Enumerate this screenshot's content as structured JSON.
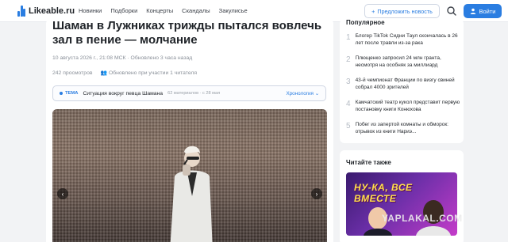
{
  "header": {
    "logo_text": "Likeable.ru",
    "nav": [
      "Новинки",
      "Подборки",
      "Концерты",
      "Скандалы",
      "Закулисье"
    ],
    "suggest_label": "Предложить новость",
    "login_label": "Войти"
  },
  "article": {
    "title": "Шаман в Лужниках трижды пытался вовлечь зал в пение — молчание",
    "date_line": "10 августа 2026 г., 21:08 МСК  ·  Обновлено 3 часа назад",
    "views": "242 просмотров",
    "updated_by": "Обновлено при участии 1 читателя",
    "theme": {
      "label": "ТЕМА",
      "title": "Ситуация вокруг певца Шамана",
      "count": "62 материалов · с 28 мая",
      "chrono": "Хронология"
    }
  },
  "sidebar": {
    "popular_heading": "Популярное",
    "popular": [
      {
        "num": "1",
        "text": "Блогер TikTok Сидни Таул скончалась в 26 лет после травли из-за рака"
      },
      {
        "num": "2",
        "text": "Плющенко запросил 24 млн гранта, несмотря на особняк за миллиард"
      },
      {
        "num": "3",
        "text": "43-й чемпионат Франции по визгу свиней собрал 4000 зрителей"
      },
      {
        "num": "4",
        "text": "Камчатский театр кукол представит первую постановку книги Конюхова"
      },
      {
        "num": "5",
        "text": "Побег из запертой комнаты и обморок: отрывок из книги Нариэ..."
      }
    ],
    "read_also_heading": "Читайте также",
    "read_also_caption": "НУ-КА, ВСЕ ВМЕСТЕ"
  },
  "watermark": "YAPLAKAL.COM",
  "colors": {
    "accent": "#2a7de1",
    "background": "#f2f3f5"
  }
}
